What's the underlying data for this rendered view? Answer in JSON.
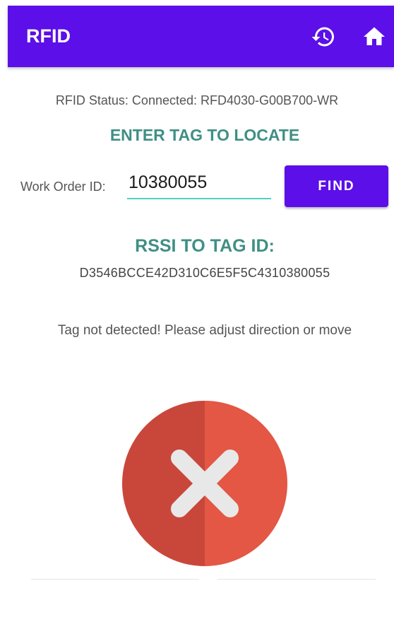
{
  "appbar": {
    "title": "RFID",
    "history_icon": "history-icon",
    "home_icon": "home-icon",
    "color": "#5c0fe8"
  },
  "status": {
    "text": "RFID Status:  Connected: RFD4030-G00B700-WR"
  },
  "locate": {
    "title": "ENTER TAG TO LOCATE",
    "work_order_label": "Work Order ID:",
    "work_order_value": "10380055",
    "find_label": "FIND"
  },
  "rssi": {
    "title": "RSSI TO TAG ID:",
    "tag_id": "D3546BCCE42D310C6E5F5C4310380055"
  },
  "detection": {
    "message": "Tag not detected! Please adjust direction or move",
    "status_icon": "error-x-icon",
    "colors": {
      "circle_left": "#c9473a",
      "circle_right": "#e35744",
      "cross": "#e8e8e8"
    }
  }
}
